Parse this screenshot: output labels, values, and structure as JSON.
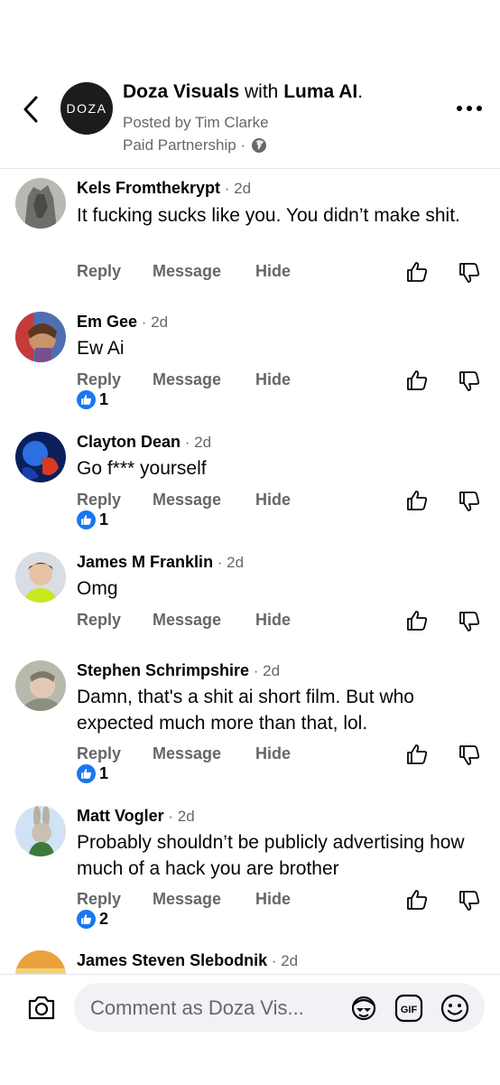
{
  "header": {
    "page_name": "Doza Visuals",
    "with_word": " with ",
    "partner_name": "Luma AI",
    "title_end": ".",
    "logo_text": "DOZA",
    "posted_by": "Posted by Tim Clarke",
    "partnership": "Paid Partnership ·",
    "icons": {
      "back": "chevron-left-icon",
      "globe": "globe-icon",
      "more": "more-dots-icon"
    }
  },
  "actions": {
    "reply": "Reply",
    "message": "Message",
    "hide": "Hide"
  },
  "comments": [
    {
      "name": "Kels Fromthekrypt",
      "time": " · 2d",
      "text": "It fucking sucks like you. You didn’t make shit.",
      "likes": ""
    },
    {
      "name": "Em Gee",
      "time": " · 2d",
      "text": "Ew Ai",
      "likes": "1"
    },
    {
      "name": "Clayton Dean",
      "time": " · 2d",
      "text": "Go f*** yourself",
      "likes": "1"
    },
    {
      "name": "James M Franklin",
      "time": " · 2d",
      "text": "Omg",
      "likes": ""
    },
    {
      "name": "Stephen Schrimpshire",
      "time": " · 2d",
      "text": "Damn, that's a shit ai short film. But who expected much more than that, lol.",
      "likes": "1"
    },
    {
      "name": "Matt Vogler",
      "time": " · 2d",
      "text": "Probably shouldn’t be publicly advertising how much of a hack you are brother",
      "likes": "2"
    },
    {
      "name": "James Steven Slebodnik",
      "time": " · 2d",
      "text": "",
      "likes": ""
    }
  ],
  "composer": {
    "placeholder": "Comment as Doza Vis...",
    "icons": {
      "camera": "camera-icon",
      "avatar_sticker": "avatar-sticker-icon",
      "gif": "gif-icon",
      "emoji": "emoji-icon"
    },
    "gif_label": "GIF"
  },
  "colors": {
    "accent": "#1877f2",
    "secondary_text": "#65676b",
    "divider": "#e4e6eb",
    "input_bg": "#f0f2f5"
  }
}
